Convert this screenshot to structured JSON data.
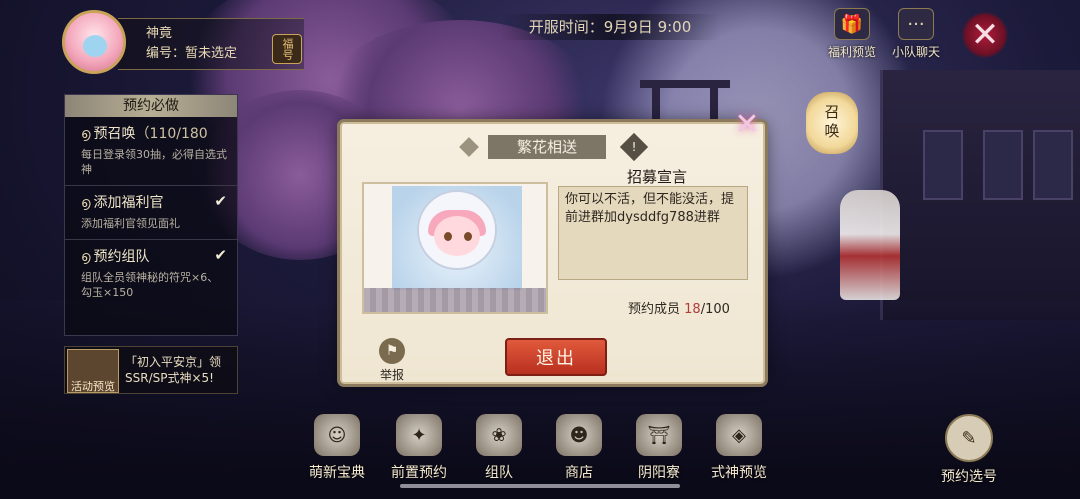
{
  "profile": {
    "name": "神竟",
    "id_text": "编号：暂未选定",
    "badge": "福号"
  },
  "open_time": "开服时间：9月9日 9:00",
  "top_right": {
    "welfare_label": "福利预览",
    "team_chat_label": "小队聊天"
  },
  "lantern_text": "召唤",
  "left_panel": {
    "header": "预约必做",
    "items": [
      {
        "title": "预召唤",
        "count": "（110/180",
        "desc": "每日登录领30抽，必得自选式神",
        "done": false
      },
      {
        "title": "添加福利官",
        "count": "",
        "desc": "添加福利官领见面礼",
        "done": true
      },
      {
        "title": "预约组队",
        "count": "",
        "desc": "组队全员领神秘的符咒×6、勾玉×150",
        "done": true
      }
    ],
    "event_preview": {
      "icon_label": "活动预览",
      "text": "「初入平安京」领SSR/SP式神×5!"
    }
  },
  "dialog": {
    "title": "繁花相送",
    "info_icon": "!",
    "declaration_title": "招募宣言",
    "declaration_text": "你可以不活，但不能没活，提前进群加dysddfg788进群",
    "members_label": "预约成员",
    "members_count": "18",
    "members_total": "/100",
    "report_label": "举报",
    "exit_label": "退出"
  },
  "bottom_nav": [
    {
      "label": "萌新宝典",
      "icon": "cat-doll-icon"
    },
    {
      "label": "前置预约",
      "icon": "bird-icon"
    },
    {
      "label": "组队",
      "icon": "rabbit-icon"
    },
    {
      "label": "商店",
      "icon": "lucky-cat-icon"
    },
    {
      "label": "阴阳寮",
      "icon": "torii-icon"
    },
    {
      "label": "式神预览",
      "icon": "fox-mask-icon"
    }
  ],
  "guess_label": "预约选号",
  "colors": {
    "exit_button": "#c8412a",
    "member_count": "#b43b3b",
    "panel_header": "#b8ae95"
  }
}
